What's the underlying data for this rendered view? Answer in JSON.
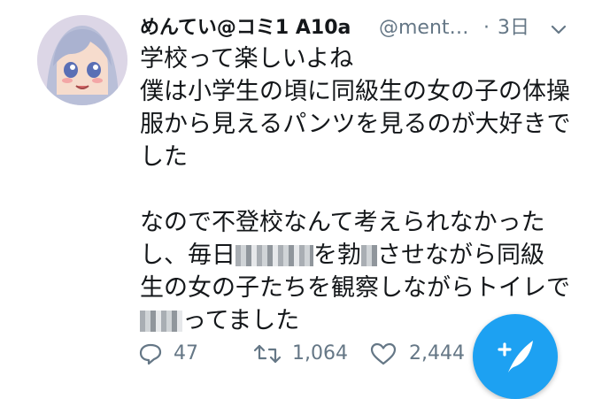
{
  "tweet": {
    "display_name": "めんてい@コミ1 A10a",
    "handle": "@ment…",
    "separator": "·",
    "time": "3日",
    "lines": [
      "学校って楽しいよね",
      "僕は小学生の頃に同級生の女の子の体操",
      "服から見えるパンツを見るのが大好きで",
      "した",
      "",
      "なので不登校なんて考えられなかった"
    ],
    "line7_a": "し、毎日",
    "line7_b": "を勃",
    "line7_c": "させながら同級",
    "line8": "生の女の子たちを観察しながらトイレで",
    "line9_b": "ってました"
  },
  "actions": {
    "reply_count": "47",
    "retweet_count": "1,064",
    "like_count": "2,444"
  },
  "colors": {
    "accent": "#1da1f2",
    "text": "#14171a",
    "muted": "#657786"
  }
}
